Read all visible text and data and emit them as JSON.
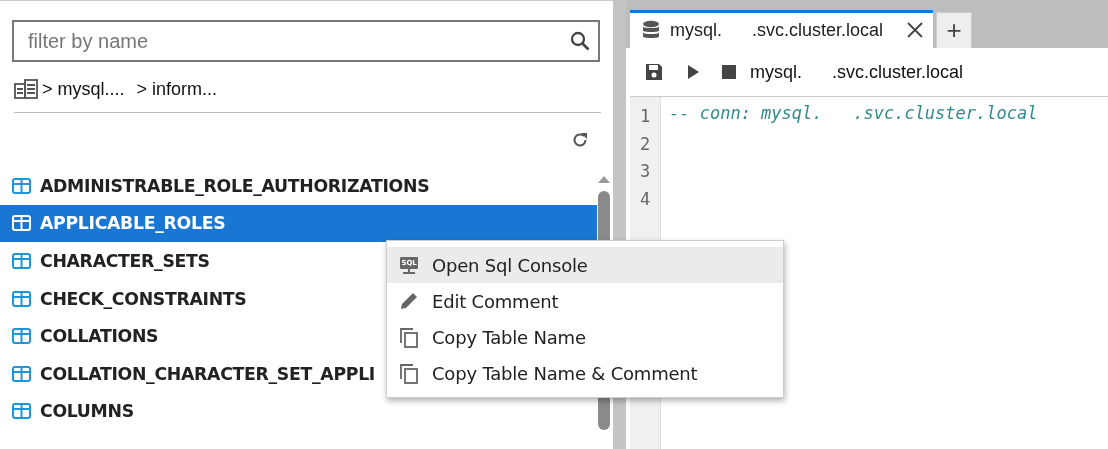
{
  "sidebar": {
    "filter": {
      "placeholder": "filter by name"
    },
    "breadcrumb": [
      "> mysql....",
      "> inform..."
    ],
    "tables": [
      {
        "label": "ADMINISTRABLE_ROLE_AUTHORIZATIONS",
        "selected": false
      },
      {
        "label": "APPLICABLE_ROLES",
        "selected": true
      },
      {
        "label": "CHARACTER_SETS",
        "selected": false
      },
      {
        "label": "CHECK_CONSTRAINTS",
        "selected": false
      },
      {
        "label": "COLLATIONS",
        "selected": false
      },
      {
        "label": "COLLATION_CHARACTER_SET_APPLI",
        "selected": false
      },
      {
        "label": "COLUMNS",
        "selected": false
      }
    ]
  },
  "editor": {
    "tabs": [
      {
        "label": "mysql.      .svc.cluster.local",
        "selected": true
      }
    ],
    "add_tab": "+",
    "toolbar": {
      "connection": "mysql.      .svc.cluster.local"
    },
    "lines": [
      {
        "number": "1",
        "code": "-- conn: mysql.   .svc.cluster.local"
      },
      {
        "number": "2"
      },
      {
        "number": "3"
      },
      {
        "number": "4"
      }
    ]
  },
  "context_menu": {
    "items": [
      {
        "kind": "sql",
        "label": "Open Sql Console",
        "icon_text": "SQL",
        "selected": true
      },
      {
        "kind": "edit",
        "label": "Edit Comment",
        "selected": false
      },
      {
        "kind": "copy",
        "label": "Copy Table Name",
        "selected": false
      },
      {
        "kind": "copy",
        "label": "Copy Table Name & Comment",
        "selected": false
      }
    ]
  }
}
